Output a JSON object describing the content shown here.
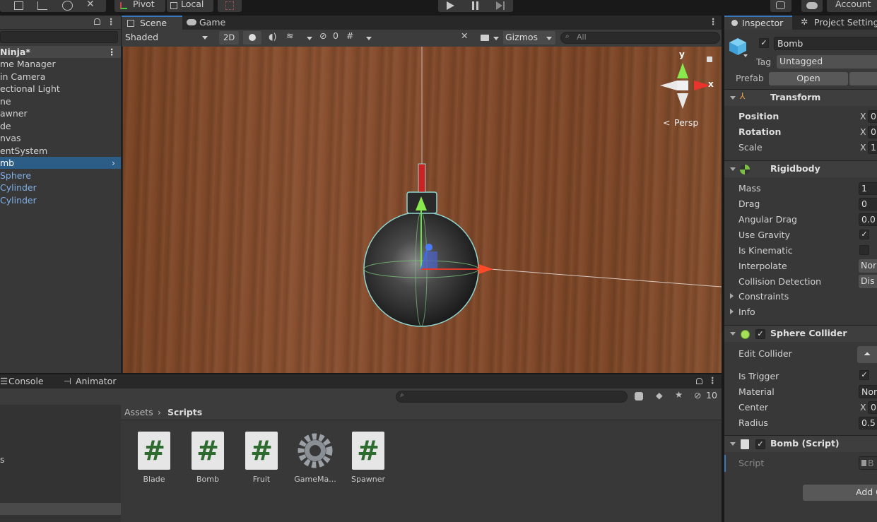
{
  "toolbar": {
    "pivot_label": "Pivot",
    "local_label": "Local",
    "account_label": "Account"
  },
  "hierarchy": {
    "scene_name": "Ninja*",
    "items": [
      {
        "label": "me Manager"
      },
      {
        "label": "in Camera"
      },
      {
        "label": "ectional Light"
      },
      {
        "label": "ne"
      },
      {
        "label": "awner"
      },
      {
        "label": "de"
      },
      {
        "label": "nvas"
      },
      {
        "label": "entSystem"
      },
      {
        "label": "mb"
      },
      {
        "label": "Sphere"
      },
      {
        "label": "Cylinder"
      },
      {
        "label": "Cylinder"
      }
    ]
  },
  "scene_view": {
    "tabs": [
      {
        "label": "Scene"
      },
      {
        "label": "Game"
      }
    ],
    "shading_mode": "Shaded",
    "mode_2d": "2D",
    "hidden_count": "0",
    "gizmos_label": "Gizmos",
    "search_placeholder": "All",
    "persp_label": "Persp",
    "axis_y": "y",
    "axis_x": "x"
  },
  "bottom_panel": {
    "tabs": [
      {
        "label": "Console"
      },
      {
        "label": "Animator"
      }
    ],
    "hidden_count": "10",
    "breadcrumb": {
      "root": "Assets",
      "current": "Scripts"
    },
    "assets": [
      {
        "name": "Blade",
        "icon": "csharp-script-icon"
      },
      {
        "name": "Bomb",
        "icon": "csharp-script-icon"
      },
      {
        "name": "Fruit",
        "icon": "csharp-script-icon"
      },
      {
        "name": "GameMa...",
        "icon": "gear-icon"
      },
      {
        "name": "Spawner",
        "icon": "csharp-script-icon"
      }
    ],
    "left_text": "s"
  },
  "inspector": {
    "tabs": [
      {
        "label": "Inspector"
      },
      {
        "label": "Project Setting"
      }
    ],
    "object_name": "Bomb",
    "tag_label": "Tag",
    "tag_value": "Untagged",
    "prefab_label": "Prefab",
    "open_label": "Open",
    "transform": {
      "title": "Transform",
      "rows": [
        {
          "label": "Position",
          "axis": "X",
          "value": "0"
        },
        {
          "label": "Rotation",
          "axis": "X",
          "value": "0"
        },
        {
          "label": "Scale",
          "axis": "X",
          "value": "1"
        }
      ]
    },
    "rigidbody": {
      "title": "Rigidbody",
      "mass_label": "Mass",
      "mass_value": "1",
      "drag_label": "Drag",
      "drag_value": "0",
      "angular_drag_label": "Angular Drag",
      "angular_drag_value": "0.0",
      "use_gravity_label": "Use Gravity",
      "is_kinematic_label": "Is Kinematic",
      "interpolate_label": "Interpolate",
      "interpolate_value": "Nor",
      "collision_label": "Collision Detection",
      "collision_value": "Dis",
      "constraints_label": "Constraints",
      "info_label": "Info"
    },
    "sphere_collider": {
      "title": "Sphere Collider",
      "edit_label": "Edit Collider",
      "is_trigger_label": "Is Trigger",
      "material_label": "Material",
      "material_value": "Nor",
      "center_label": "Center",
      "center_axis": "X",
      "center_value": "0",
      "radius_label": "Radius",
      "radius_value": "0.5"
    },
    "bomb_script": {
      "title": "Bomb (Script)",
      "script_label": "Script",
      "script_value": "B"
    },
    "add_component_label": "Add C"
  }
}
